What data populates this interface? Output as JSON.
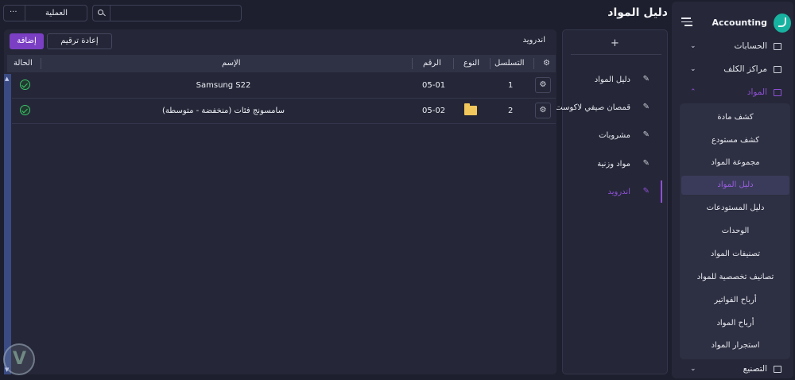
{
  "app": {
    "name": "Accounting",
    "page_title": "دليل المواد"
  },
  "topbar": {
    "search_placeholder": "",
    "operation_label": "العملية",
    "more_label": "···"
  },
  "sidebar": {
    "groups": [
      {
        "label": "الحسابات",
        "icon": "book-icon",
        "expanded": false
      },
      {
        "label": "مراكز الكلف",
        "icon": "cost-center-icon",
        "expanded": false
      },
      {
        "label": "المواد",
        "icon": "materials-icon",
        "expanded": true
      },
      {
        "label": "التصنيع",
        "icon": "manufacturing-icon",
        "expanded": false
      }
    ],
    "materials_submenu": [
      "كشف مادة",
      "كشف مستودع",
      "مجموعة المواد",
      "دليل المواد",
      "دليل المستودعات",
      "الوحدات",
      "تصنيفات المواد",
      "تصانيف تخصصية للمواد",
      "أرباح الفواتير",
      "أرباح المواد",
      "استجرار المواد"
    ],
    "active_submenu": "دليل المواد"
  },
  "categories": {
    "add_label": "+",
    "items": [
      {
        "label": "دليل المواد",
        "active": false
      },
      {
        "label": "قمصان صيفي لاكوست",
        "active": false
      },
      {
        "label": "مشروبات",
        "active": false
      },
      {
        "label": "مواد وزنية",
        "active": false
      },
      {
        "label": "اندرويد",
        "active": true
      }
    ]
  },
  "main": {
    "breadcrumb": "اندرويد",
    "add_button": "إضافة",
    "renumber_button": "إعادة ترقيم",
    "columns": {
      "settings": "",
      "sequence": "التسلسل",
      "type": "النوع",
      "number": "الرقم",
      "name": "الإسم",
      "status": "الحالة"
    },
    "rows": [
      {
        "sequence": "1",
        "type": "",
        "number": "05-01",
        "name": "Samsung S22",
        "status": "ok"
      },
      {
        "sequence": "2",
        "type": "folder",
        "number": "05-02",
        "name": "سامسونج فئات (منخفضة - متوسطة)",
        "status": "ok"
      }
    ]
  },
  "colors": {
    "accent": "#7b3fc4",
    "background": "#1d1f2e",
    "panel": "#252738",
    "status_ok": "#3cc26a",
    "folder": "#f2c75b"
  }
}
